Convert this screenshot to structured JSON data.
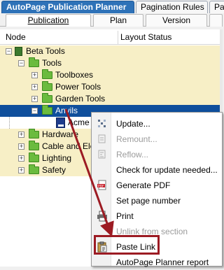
{
  "main_tabs": [
    {
      "label": "AutoPage Publication Planner",
      "active": true
    },
    {
      "label": "Pagination Rules",
      "active": false
    },
    {
      "label": "Pag",
      "active": false
    }
  ],
  "sub_tabs": [
    {
      "label": "Publication",
      "active": true
    },
    {
      "label": "Plan",
      "active": false
    },
    {
      "label": "Version",
      "active": false
    }
  ],
  "columns": {
    "node": "Node",
    "layout_status": "Layout Status"
  },
  "tree": [
    {
      "label": "Beta Tools"
    },
    {
      "label": "Tools"
    },
    {
      "label": "Toolboxes"
    },
    {
      "label": "Power Tools"
    },
    {
      "label": "Garden Tools"
    },
    {
      "label": "Anvils"
    },
    {
      "label": "Acme A"
    },
    {
      "label": "Hardware"
    },
    {
      "label": "Cable and Elect"
    },
    {
      "label": "Lighting"
    },
    {
      "label": "Safety"
    }
  ],
  "context_menu": [
    {
      "label": "Update...",
      "enabled": true,
      "icon": "update-icon"
    },
    {
      "label": "Remount...",
      "enabled": false,
      "icon": "remount-icon"
    },
    {
      "label": "Reflow...",
      "enabled": false,
      "icon": "reflow-icon"
    },
    {
      "label": "Check for update needed...",
      "enabled": true,
      "icon": ""
    },
    {
      "label": "Generate PDF",
      "enabled": true,
      "icon": "pdf-icon"
    },
    {
      "label": "Set page number",
      "enabled": true,
      "icon": ""
    },
    {
      "label": "Print",
      "enabled": true,
      "icon": "printer-icon"
    },
    {
      "label": "Unlink from section",
      "enabled": false,
      "icon": ""
    },
    {
      "label": "Paste Link",
      "enabled": true,
      "icon": "clipboard-icon"
    },
    {
      "label": "AutoPage Planner report",
      "enabled": true,
      "icon": ""
    }
  ],
  "colors": {
    "accent": "#2e72b8",
    "selection": "#0f4f9c",
    "highlight": "#9c1b23",
    "row_shade": "#f7efc6",
    "folder": "#6bbb3e"
  }
}
